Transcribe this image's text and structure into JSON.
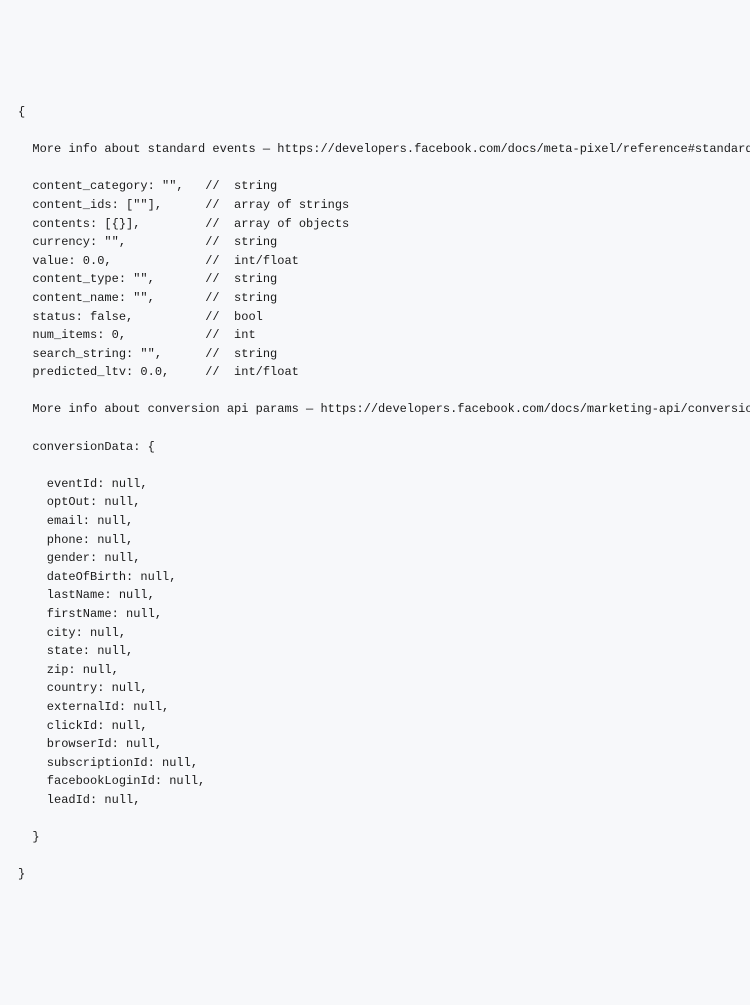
{
  "code": {
    "opening_brace": "{",
    "comment_line_1": "  More info about standard events — https://developers.facebook.com/docs/meta-pixel/reference#standard-events",
    "params": [
      {
        "key": "content_category",
        "value": "\"\"",
        "type": "string"
      },
      {
        "key": "content_ids",
        "value": "[\"\"]",
        "type": "array of strings"
      },
      {
        "key": "contents",
        "value": "[{}]",
        "type": "array of objects"
      },
      {
        "key": "currency",
        "value": "\"\"",
        "type": "string"
      },
      {
        "key": "value",
        "value": "0.0",
        "type": "int/float"
      },
      {
        "key": "content_type",
        "value": "\"\"",
        "type": "string"
      },
      {
        "key": "content_name",
        "value": "\"\"",
        "type": "string"
      },
      {
        "key": "status",
        "value": "false",
        "type": "bool"
      },
      {
        "key": "num_items",
        "value": "0",
        "type": "int"
      },
      {
        "key": "search_string",
        "value": "\"\"",
        "type": "string"
      },
      {
        "key": "predicted_ltv",
        "value": "0.0",
        "type": "int/float"
      }
    ],
    "comment_line_2": "  More info about conversion api params — https://developers.facebook.com/docs/marketing-api/conversions-api",
    "conversion_header": "  conversionData: {",
    "conversion_fields": [
      "eventId",
      "optOut",
      "email",
      "phone",
      "gender",
      "dateOfBirth",
      "lastName",
      "firstName",
      "city",
      "state",
      "zip",
      "country",
      "externalId",
      "clickId",
      "browserId",
      "subscriptionId",
      "facebookLoginId",
      "leadId"
    ],
    "conversion_close": "  }",
    "closing_brace": "}"
  }
}
